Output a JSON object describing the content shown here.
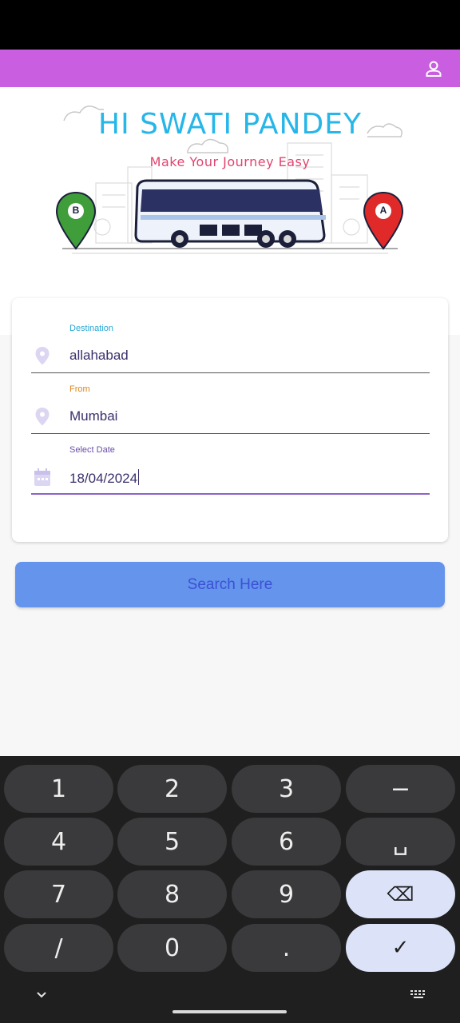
{
  "header": {
    "profile_icon": "person-icon"
  },
  "banner": {
    "greeting": "HI SWATI PANDEY",
    "tagline": "Make Your Journey Easy",
    "pin_b": "B",
    "pin_a": "A"
  },
  "form": {
    "destination": {
      "label": "Destination",
      "value": "allahabad",
      "icon": "location-pin-icon",
      "label_color": "#2aa7d4"
    },
    "from": {
      "label": "From",
      "value": "Mumbai",
      "icon": "location-pin-icon",
      "label_color": "#d9861f"
    },
    "date": {
      "label": "Select Date",
      "value": "18/04/2024",
      "icon": "calendar-icon",
      "label_color": "#6a4fa8"
    }
  },
  "search_button": {
    "label": "Search Here"
  },
  "keyboard": {
    "keys": [
      "1",
      "2",
      "3",
      "−",
      "4",
      "5",
      "6",
      "␣",
      "7",
      "8",
      "9",
      "⌫",
      "/",
      "0",
      ".",
      "✓"
    ],
    "hide_icon": "chevron-down-icon",
    "switch_icon": "keyboard-icon"
  },
  "colors": {
    "app_bar": "#c95fe0",
    "accent": "#8a63c9",
    "button": "#6494eb"
  }
}
